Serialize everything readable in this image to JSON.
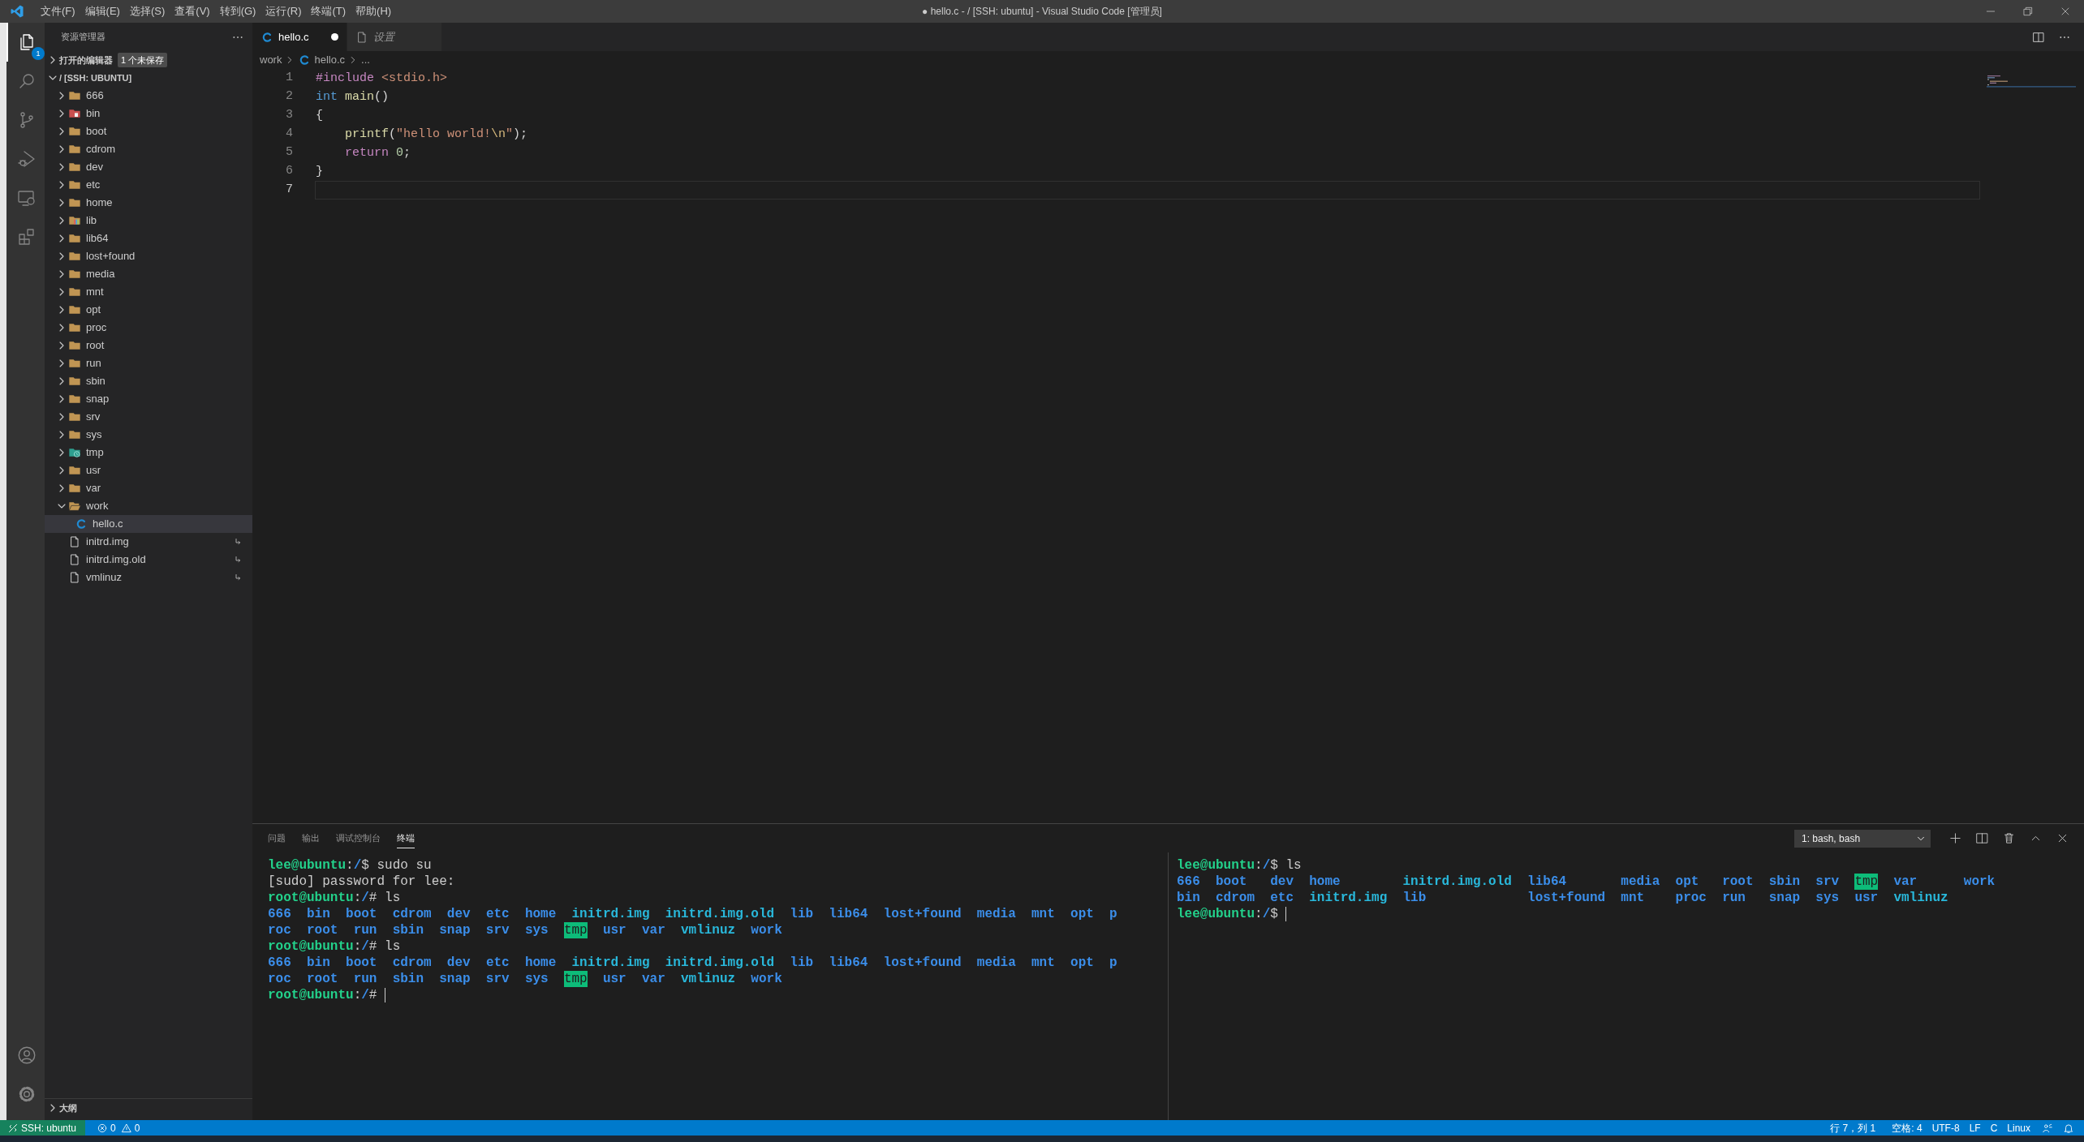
{
  "window": {
    "title": "● hello.c - / [SSH: ubuntu] - Visual Studio Code [管理员]"
  },
  "menu": [
    "文件(F)",
    "编辑(E)",
    "选择(S)",
    "查看(V)",
    "转到(G)",
    "运行(R)",
    "终端(T)",
    "帮助(H)"
  ],
  "activity_bar": {
    "items": [
      {
        "kind": "explorer",
        "selected": true,
        "badge": "1"
      },
      {
        "kind": "search",
        "selected": false
      },
      {
        "kind": "source-control",
        "selected": false
      },
      {
        "kind": "run",
        "selected": false
      },
      {
        "kind": "remote",
        "selected": false
      },
      {
        "kind": "extensions",
        "selected": false
      }
    ],
    "bottom": [
      {
        "kind": "account"
      },
      {
        "kind": "settings"
      }
    ]
  },
  "sidebar": {
    "title": "资源管理器",
    "open_editors": {
      "title": "打开的编辑器",
      "badge": "1 个未保存",
      "expanded": false
    },
    "folder": {
      "title": "/ [SSH: UBUNTU]",
      "expanded": true,
      "tree": [
        {
          "name": "666",
          "kind": "folder",
          "expanded": false,
          "selected": false
        },
        {
          "name": "bin",
          "kind": "folder-bin",
          "expanded": false,
          "selected": false
        },
        {
          "name": "boot",
          "kind": "folder",
          "expanded": false,
          "selected": false
        },
        {
          "name": "cdrom",
          "kind": "folder",
          "expanded": false,
          "selected": false
        },
        {
          "name": "dev",
          "kind": "folder",
          "expanded": false,
          "selected": false
        },
        {
          "name": "etc",
          "kind": "folder",
          "expanded": false,
          "selected": false
        },
        {
          "name": "home",
          "kind": "folder",
          "expanded": false,
          "selected": false
        },
        {
          "name": "lib",
          "kind": "folder-lib",
          "expanded": false,
          "selected": false
        },
        {
          "name": "lib64",
          "kind": "folder",
          "expanded": false,
          "selected": false
        },
        {
          "name": "lost+found",
          "kind": "folder",
          "expanded": false,
          "selected": false
        },
        {
          "name": "media",
          "kind": "folder",
          "expanded": false,
          "selected": false
        },
        {
          "name": "mnt",
          "kind": "folder",
          "expanded": false,
          "selected": false
        },
        {
          "name": "opt",
          "kind": "folder",
          "expanded": false,
          "selected": false
        },
        {
          "name": "proc",
          "kind": "folder",
          "expanded": false,
          "selected": false
        },
        {
          "name": "root",
          "kind": "folder",
          "expanded": false,
          "selected": false
        },
        {
          "name": "run",
          "kind": "folder",
          "expanded": false,
          "selected": false
        },
        {
          "name": "sbin",
          "kind": "folder",
          "expanded": false,
          "selected": false
        },
        {
          "name": "snap",
          "kind": "folder",
          "expanded": false,
          "selected": false
        },
        {
          "name": "srv",
          "kind": "folder",
          "expanded": false,
          "selected": false
        },
        {
          "name": "sys",
          "kind": "folder",
          "expanded": false,
          "selected": false
        },
        {
          "name": "tmp",
          "kind": "folder-temp",
          "expanded": false,
          "selected": false
        },
        {
          "name": "usr",
          "kind": "folder",
          "expanded": false,
          "selected": false
        },
        {
          "name": "var",
          "kind": "folder",
          "expanded": false,
          "selected": false
        },
        {
          "name": "work",
          "kind": "folder",
          "expanded": true,
          "selected": false,
          "children": [
            {
              "name": "hello.c",
              "kind": "c-file",
              "selected": true
            }
          ]
        },
        {
          "name": "initrd.img",
          "kind": "file",
          "symlink": true,
          "selected": false
        },
        {
          "name": "initrd.img.old",
          "kind": "file",
          "symlink": true,
          "selected": false
        },
        {
          "name": "vmlinuz",
          "kind": "file",
          "symlink": true,
          "selected": false
        }
      ]
    },
    "outline": {
      "title": "大纲",
      "expanded": false
    }
  },
  "editor": {
    "tabs": [
      {
        "label": "hello.c",
        "kind": "c-file",
        "selected": true,
        "dirty": true,
        "preview": false
      },
      {
        "label": "设置",
        "kind": "file",
        "selected": false,
        "dirty": false,
        "preview": true
      }
    ],
    "breadcrumb": [
      {
        "text": "work",
        "kind": "folder"
      },
      {
        "text": "hello.c",
        "kind": "c-file"
      },
      {
        "text": "...",
        "kind": "more"
      }
    ],
    "lines": [
      {
        "number": "1",
        "current": false,
        "tokens": [
          {
            "kind": "directive",
            "text": "#include"
          },
          {
            "kind": "string",
            "text": " <stdio.h>"
          }
        ]
      },
      {
        "number": "2",
        "current": false,
        "tokens": [
          {
            "kind": "type",
            "text": "int"
          },
          {
            "kind": "func",
            "text": " main"
          },
          {
            "kind": "plain",
            "text": "()"
          }
        ]
      },
      {
        "number": "3",
        "current": false,
        "tokens": [
          {
            "kind": "plain",
            "text": "{"
          }
        ]
      },
      {
        "number": "4",
        "current": false,
        "tokens": [
          {
            "kind": "func",
            "text": "    printf"
          },
          {
            "kind": "plain",
            "text": "("
          },
          {
            "kind": "string",
            "text": "\"hello world!"
          },
          {
            "kind": "escape",
            "text": "\\n"
          },
          {
            "kind": "string",
            "text": "\""
          },
          {
            "kind": "plain",
            "text": ");"
          }
        ]
      },
      {
        "number": "5",
        "current": false,
        "tokens": [
          {
            "kind": "control",
            "text": "    return"
          },
          {
            "kind": "number",
            "text": " 0"
          },
          {
            "kind": "plain",
            "text": ";"
          }
        ]
      },
      {
        "number": "6",
        "current": false,
        "tokens": [
          {
            "kind": "plain",
            "text": "}"
          }
        ]
      },
      {
        "number": "7",
        "current": true
      }
    ]
  },
  "panel": {
    "tabs": [
      {
        "label": "问题",
        "selected": false
      },
      {
        "label": "输出",
        "selected": false
      },
      {
        "label": "调试控制台",
        "selected": false
      },
      {
        "label": "终端",
        "selected": true
      }
    ],
    "terminal_selector": "1: bash, bash",
    "panes": [
      {
        "lines": [
          {
            "kind": "text",
            "segments": [
              {
                "kind": "user",
                "text": "lee@ubuntu"
              },
              {
                "kind": "plain",
                "text": ":"
              },
              {
                "kind": "path",
                "text": "/"
              },
              {
                "kind": "plain",
                "text": "$ sudo su"
              }
            ]
          },
          {
            "kind": "text",
            "segments": [
              {
                "kind": "plain",
                "text": "[sudo] password for lee:"
              }
            ]
          },
          {
            "kind": "text",
            "segments": [
              {
                "kind": "user",
                "text": "root@ubuntu"
              },
              {
                "kind": "plain",
                "text": ":"
              },
              {
                "kind": "path",
                "text": "/"
              },
              {
                "kind": "plain",
                "text": "# ls"
              }
            ]
          },
          {
            "kind": "ls-row",
            "entries": [
              {
                "name": "666",
                "kind": "dir"
              },
              {
                "name": "bin",
                "kind": "dir"
              },
              {
                "name": "boot",
                "kind": "dir"
              },
              {
                "name": "cdrom",
                "kind": "dir"
              },
              {
                "name": "dev",
                "kind": "dir"
              },
              {
                "name": "etc",
                "kind": "dir"
              },
              {
                "name": "home",
                "kind": "dir"
              },
              {
                "name": "initrd.img",
                "kind": "link"
              },
              {
                "name": "initrd.img.old",
                "kind": "link"
              },
              {
                "name": "lib",
                "kind": "dir"
              },
              {
                "name": "lib64",
                "kind": "dir"
              },
              {
                "name": "lost+found",
                "kind": "dir"
              },
              {
                "name": "media",
                "kind": "dir"
              },
              {
                "name": "mnt",
                "kind": "dir"
              },
              {
                "name": "opt",
                "kind": "dir"
              },
              {
                "name": "p",
                "kind": "dir"
              }
            ]
          },
          {
            "kind": "ls-row",
            "entries": [
              {
                "name": "roc",
                "kind": "dir"
              },
              {
                "name": "root",
                "kind": "dir"
              },
              {
                "name": "run",
                "kind": "dir"
              },
              {
                "name": "sbin",
                "kind": "dir"
              },
              {
                "name": "snap",
                "kind": "dir"
              },
              {
                "name": "srv",
                "kind": "dir"
              },
              {
                "name": "sys",
                "kind": "dir"
              },
              {
                "name": "tmp",
                "kind": "sticky"
              },
              {
                "name": "usr",
                "kind": "dir"
              },
              {
                "name": "var",
                "kind": "dir"
              },
              {
                "name": "vmlinuz",
                "kind": "link"
              },
              {
                "name": "work",
                "kind": "dir"
              }
            ]
          },
          {
            "kind": "text",
            "segments": [
              {
                "kind": "user",
                "text": "root@ubuntu"
              },
              {
                "kind": "plain",
                "text": ":"
              },
              {
                "kind": "path",
                "text": "/"
              },
              {
                "kind": "plain",
                "text": "# ls"
              }
            ]
          },
          {
            "kind": "ls-row",
            "entries": [
              {
                "name": "666",
                "kind": "dir"
              },
              {
                "name": "bin",
                "kind": "dir"
              },
              {
                "name": "boot",
                "kind": "dir"
              },
              {
                "name": "cdrom",
                "kind": "dir"
              },
              {
                "name": "dev",
                "kind": "dir"
              },
              {
                "name": "etc",
                "kind": "dir"
              },
              {
                "name": "home",
                "kind": "dir"
              },
              {
                "name": "initrd.img",
                "kind": "link"
              },
              {
                "name": "initrd.img.old",
                "kind": "link"
              },
              {
                "name": "lib",
                "kind": "dir"
              },
              {
                "name": "lib64",
                "kind": "dir"
              },
              {
                "name": "lost+found",
                "kind": "dir"
              },
              {
                "name": "media",
                "kind": "dir"
              },
              {
                "name": "mnt",
                "kind": "dir"
              },
              {
                "name": "opt",
                "kind": "dir"
              },
              {
                "name": "p",
                "kind": "dir"
              }
            ]
          },
          {
            "kind": "ls-row",
            "entries": [
              {
                "name": "roc",
                "kind": "dir"
              },
              {
                "name": "root",
                "kind": "dir"
              },
              {
                "name": "run",
                "kind": "dir"
              },
              {
                "name": "sbin",
                "kind": "dir"
              },
              {
                "name": "snap",
                "kind": "dir"
              },
              {
                "name": "srv",
                "kind": "dir"
              },
              {
                "name": "sys",
                "kind": "dir"
              },
              {
                "name": "tmp",
                "kind": "sticky"
              },
              {
                "name": "usr",
                "kind": "dir"
              },
              {
                "name": "var",
                "kind": "dir"
              },
              {
                "name": "vmlinuz",
                "kind": "link"
              },
              {
                "name": "work",
                "kind": "dir"
              }
            ]
          },
          {
            "kind": "text",
            "cursor": true,
            "segments": [
              {
                "kind": "user",
                "text": "root@ubuntu"
              },
              {
                "kind": "plain",
                "text": ":"
              },
              {
                "kind": "path",
                "text": "/"
              },
              {
                "kind": "plain",
                "text": "#"
              }
            ]
          }
        ]
      },
      {
        "lines": [
          {
            "kind": "text",
            "segments": [
              {
                "kind": "user",
                "text": "lee@ubuntu"
              },
              {
                "kind": "plain",
                "text": ":"
              },
              {
                "kind": "path",
                "text": "/"
              },
              {
                "kind": "plain",
                "text": "$ ls"
              }
            ]
          },
          {
            "kind": "ls-grid",
            "rows": [
              [
                {
                  "name": "666",
                  "kind": "dir"
                },
                {
                  "name": "boot",
                  "kind": "dir"
                },
                {
                  "name": "dev",
                  "kind": "dir"
                },
                {
                  "name": "home",
                  "kind": "dir"
                },
                {
                  "name": "initrd.img.old",
                  "kind": "link"
                },
                {
                  "name": "lib64",
                  "kind": "dir"
                },
                {
                  "name": "media",
                  "kind": "dir"
                },
                {
                  "name": "opt",
                  "kind": "dir"
                },
                {
                  "name": "root",
                  "kind": "dir"
                },
                {
                  "name": "sbin",
                  "kind": "dir"
                },
                {
                  "name": "srv",
                  "kind": "dir"
                },
                {
                  "name": "tmp",
                  "kind": "sticky"
                },
                {
                  "name": "var",
                  "kind": "dir"
                },
                {
                  "name": "work",
                  "kind": "dir"
                }
              ],
              [
                {
                  "name": "bin",
                  "kind": "dir"
                },
                {
                  "name": "cdrom",
                  "kind": "dir"
                },
                {
                  "name": "etc",
                  "kind": "dir"
                },
                {
                  "name": "initrd.img",
                  "kind": "link"
                },
                {
                  "name": "lib",
                  "kind": "dir"
                },
                {
                  "name": "lost+found",
                  "kind": "dir"
                },
                {
                  "name": "mnt",
                  "kind": "dir"
                },
                {
                  "name": "proc",
                  "kind": "dir"
                },
                {
                  "name": "run",
                  "kind": "dir"
                },
                {
                  "name": "snap",
                  "kind": "dir"
                },
                {
                  "name": "sys",
                  "kind": "dir"
                },
                {
                  "name": "usr",
                  "kind": "dir"
                },
                {
                  "name": "vmlinuz",
                  "kind": "link"
                }
              ]
            ]
          },
          {
            "kind": "text",
            "cursor": true,
            "segments": [
              {
                "kind": "user",
                "text": "lee@ubuntu"
              },
              {
                "kind": "plain",
                "text": ":"
              },
              {
                "kind": "path",
                "text": "/"
              },
              {
                "kind": "plain",
                "text": "$"
              }
            ]
          }
        ]
      }
    ]
  },
  "status_bar": {
    "left": [
      {
        "kind": "remote",
        "text": "SSH: ubuntu"
      },
      {
        "kind": "problems",
        "errors": "0",
        "warnings": "0"
      }
    ],
    "right": [
      "行 7，列 1",
      "空格: 4",
      "UTF-8",
      "LF",
      "C",
      "Linux"
    ]
  }
}
